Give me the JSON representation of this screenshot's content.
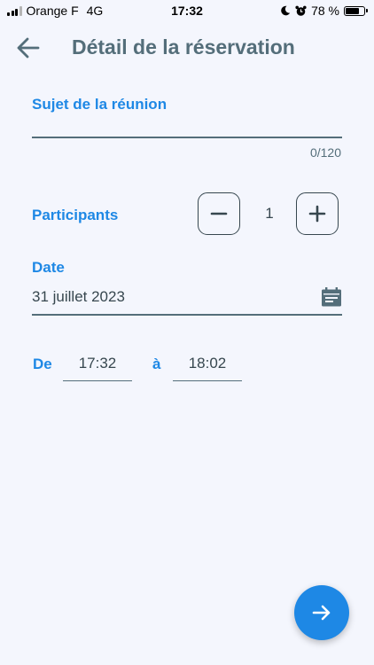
{
  "status_bar": {
    "carrier": "Orange F",
    "network": "4G",
    "time": "17:32",
    "battery_percent": "78 %",
    "battery_level": 0.78,
    "icons": [
      "signal-icon",
      "moon-icon",
      "alarm-icon",
      "battery-icon"
    ]
  },
  "header": {
    "title": "Détail de la réservation",
    "back_icon": "arrow-left-icon"
  },
  "form": {
    "subject": {
      "label": "Sujet de la réunion",
      "value": "",
      "counter": "0/120"
    },
    "participants": {
      "label": "Participants",
      "value": "1",
      "decrement_icon": "minus-icon",
      "increment_icon": "plus-icon"
    },
    "date": {
      "label": "Date",
      "value": "31 juillet 2023",
      "icon": "calendar-icon"
    },
    "time": {
      "from_label": "De",
      "from": "17:32",
      "to_label": "à",
      "to": "18:02"
    }
  },
  "fab": {
    "icon": "arrow-right-icon"
  },
  "colors": {
    "accent": "#1e88e5",
    "text": "#37474f",
    "title": "#546e7a",
    "background": "#f4f6fd"
  }
}
